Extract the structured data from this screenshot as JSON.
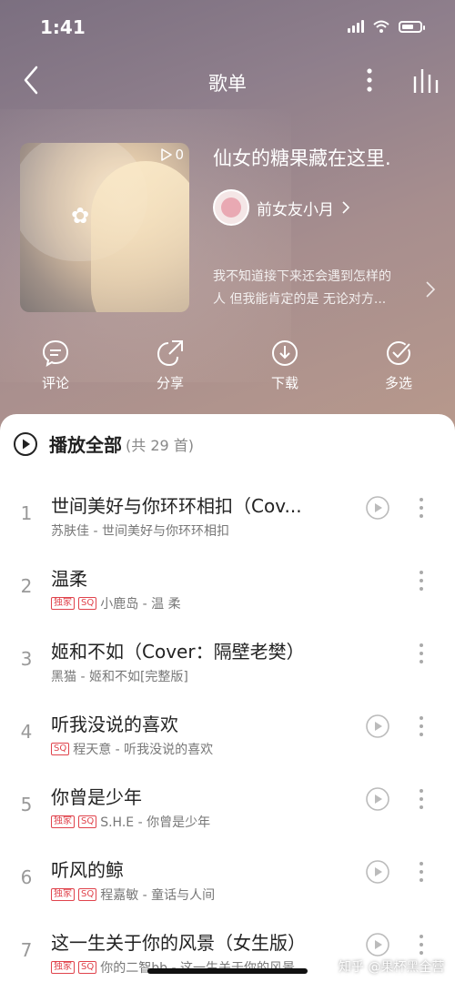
{
  "status": {
    "time": "1:41"
  },
  "nav": {
    "title": "歌单"
  },
  "playlist": {
    "play_count": "0",
    "title": "仙女的糖果藏在这里.",
    "creator": "前女友小月",
    "description_line1": "我不知道接下来还会遇到怎样的",
    "description_line2": "人 但我能肯定的是 无论对方..."
  },
  "actions": [
    {
      "label": "评论",
      "icon": "comment-icon"
    },
    {
      "label": "分享",
      "icon": "share-icon"
    },
    {
      "label": "下载",
      "icon": "download-icon"
    },
    {
      "label": "多选",
      "icon": "multiselect-icon"
    }
  ],
  "play_all": {
    "label": "播放全部",
    "count": "(共 29 首)"
  },
  "tags": {
    "exclusive": "独家",
    "sq": "SQ"
  },
  "songs": [
    {
      "index": "1",
      "title": "世间美好与你环环相扣（Cov...",
      "artist_album": "苏肤佳 - 世间美好与你环环相扣"
    },
    {
      "index": "2",
      "title": "温柔",
      "artist_album": "小鹿岛 - 温 柔"
    },
    {
      "index": "3",
      "title": "姬和不如（Cover：隔壁老樊）",
      "artist_album": "黑猫 - 姬和不如[完整版]"
    },
    {
      "index": "4",
      "title": "听我没说的喜欢",
      "artist_album": "程天意 - 听我没说的喜欢"
    },
    {
      "index": "5",
      "title": "你曾是少年",
      "artist_album": "S.H.E - 你曾是少年"
    },
    {
      "index": "6",
      "title": "听风的鲸",
      "artist_album": "程嘉敏 - 童话与人间"
    },
    {
      "index": "7",
      "title": "这一生关于你的风景（女生版）",
      "artist_album": "你的二智bb - 这一生关于你的风景"
    }
  ],
  "watermark": "知乎 @果杯黑全营",
  "colors": {
    "accent": "#e0434c",
    "hero": "#8f7f8c"
  }
}
